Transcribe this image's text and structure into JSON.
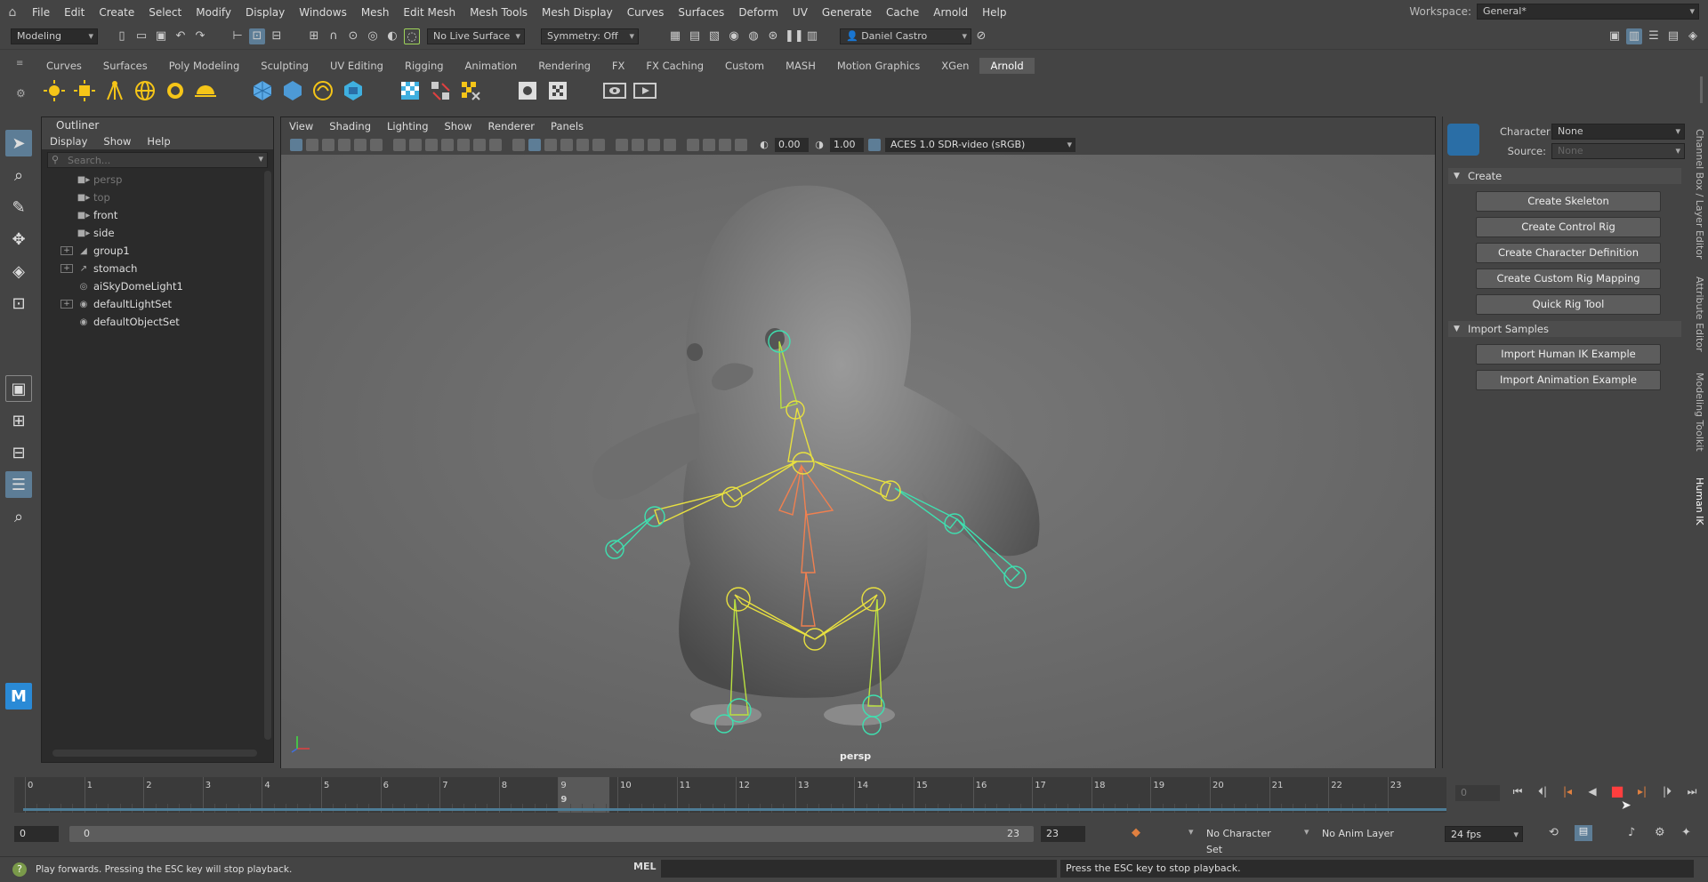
{
  "menubar": {
    "items": [
      "File",
      "Edit",
      "Create",
      "Select",
      "Modify",
      "Display",
      "Windows",
      "Mesh",
      "Edit Mesh",
      "Mesh Tools",
      "Mesh Display",
      "Curves",
      "Surfaces",
      "Deform",
      "UV",
      "Generate",
      "Cache",
      "Arnold",
      "Help"
    ],
    "workspace_label": "Workspace:",
    "workspace_value": "General*"
  },
  "statusline": {
    "menuset": "Modeling",
    "live_surface": "No Live Surface",
    "symmetry": "Symmetry: Off",
    "user": "Daniel Castro"
  },
  "shelf": {
    "tabs": [
      "Curves",
      "Surfaces",
      "Poly Modeling",
      "Sculpting",
      "UV Editing",
      "Rigging",
      "Animation",
      "Rendering",
      "FX",
      "FX Caching",
      "Custom",
      "MASH",
      "Motion Graphics",
      "XGen",
      "Arnold"
    ],
    "active_tab": "Arnold"
  },
  "outliner": {
    "title": "Outliner",
    "menu": [
      "Display",
      "Show",
      "Help"
    ],
    "search_placeholder": "Search...",
    "items": [
      {
        "label": "persp",
        "icon": "camera-icon",
        "expandable": false,
        "dim": true
      },
      {
        "label": "top",
        "icon": "camera-icon",
        "expandable": false,
        "dim": true
      },
      {
        "label": "front",
        "icon": "camera-icon",
        "expandable": false,
        "dim": false
      },
      {
        "label": "side",
        "icon": "camera-icon",
        "expandable": false,
        "dim": false
      },
      {
        "label": "group1",
        "icon": "group-icon",
        "expandable": true,
        "dim": false
      },
      {
        "label": "stomach",
        "icon": "joint-icon",
        "expandable": true,
        "dim": false
      },
      {
        "label": "aiSkyDomeLight1",
        "icon": "light-icon",
        "expandable": false,
        "dim": false
      },
      {
        "label": "defaultLightSet",
        "icon": "set-icon",
        "expandable": true,
        "dim": false
      },
      {
        "label": "defaultObjectSet",
        "icon": "set-icon",
        "expandable": false,
        "dim": false
      }
    ]
  },
  "viewport": {
    "menu": [
      "View",
      "Shading",
      "Lighting",
      "Show",
      "Renderer",
      "Panels"
    ],
    "exposure": "0.00",
    "gamma": "1.00",
    "colorspace": "ACES 1.0 SDR-video (sRGB)",
    "camera_label": "persp"
  },
  "humanik": {
    "character_label": "Character:",
    "character_value": "None",
    "source_label": "Source:",
    "source_value": "None",
    "create_section": "Create",
    "create_buttons": [
      "Create Skeleton",
      "Create Control Rig",
      "Create Character Definition",
      "Create Custom Rig Mapping",
      "Quick Rig Tool"
    ],
    "import_section": "Import Samples",
    "import_buttons": [
      "Import Human IK Example",
      "Import Animation Example"
    ]
  },
  "side_tabs": [
    "Channel Box / Layer Editor",
    "Attribute Editor",
    "Modeling Toolkit",
    "Human IK"
  ],
  "timeline": {
    "ticks": [
      "0",
      "1",
      "2",
      "3",
      "4",
      "5",
      "6",
      "7",
      "8",
      "9",
      "10",
      "11",
      "12",
      "13",
      "14",
      "15",
      "16",
      "17",
      "18",
      "19",
      "20",
      "21",
      "22",
      "23"
    ],
    "current_frame": "9",
    "current_frame_field": "0"
  },
  "range": {
    "start": "0",
    "inner_start": "0",
    "inner_end": "23",
    "end": "23",
    "character_set": "No Character Set",
    "anim_layer": "No Anim Layer",
    "fps": "24 fps"
  },
  "helpline": {
    "message": "Play forwards. Pressing the ESC key will stop playback.",
    "mel_label": "MEL",
    "script_output": "Press the ESC key to stop playback."
  },
  "colors": {
    "accent_blue": "#5d7d96",
    "stop_red": "#ff3e3e",
    "joint_green": "#3fe0b0",
    "joint_yellow": "#e8e040",
    "joint_orange": "#f08050"
  }
}
